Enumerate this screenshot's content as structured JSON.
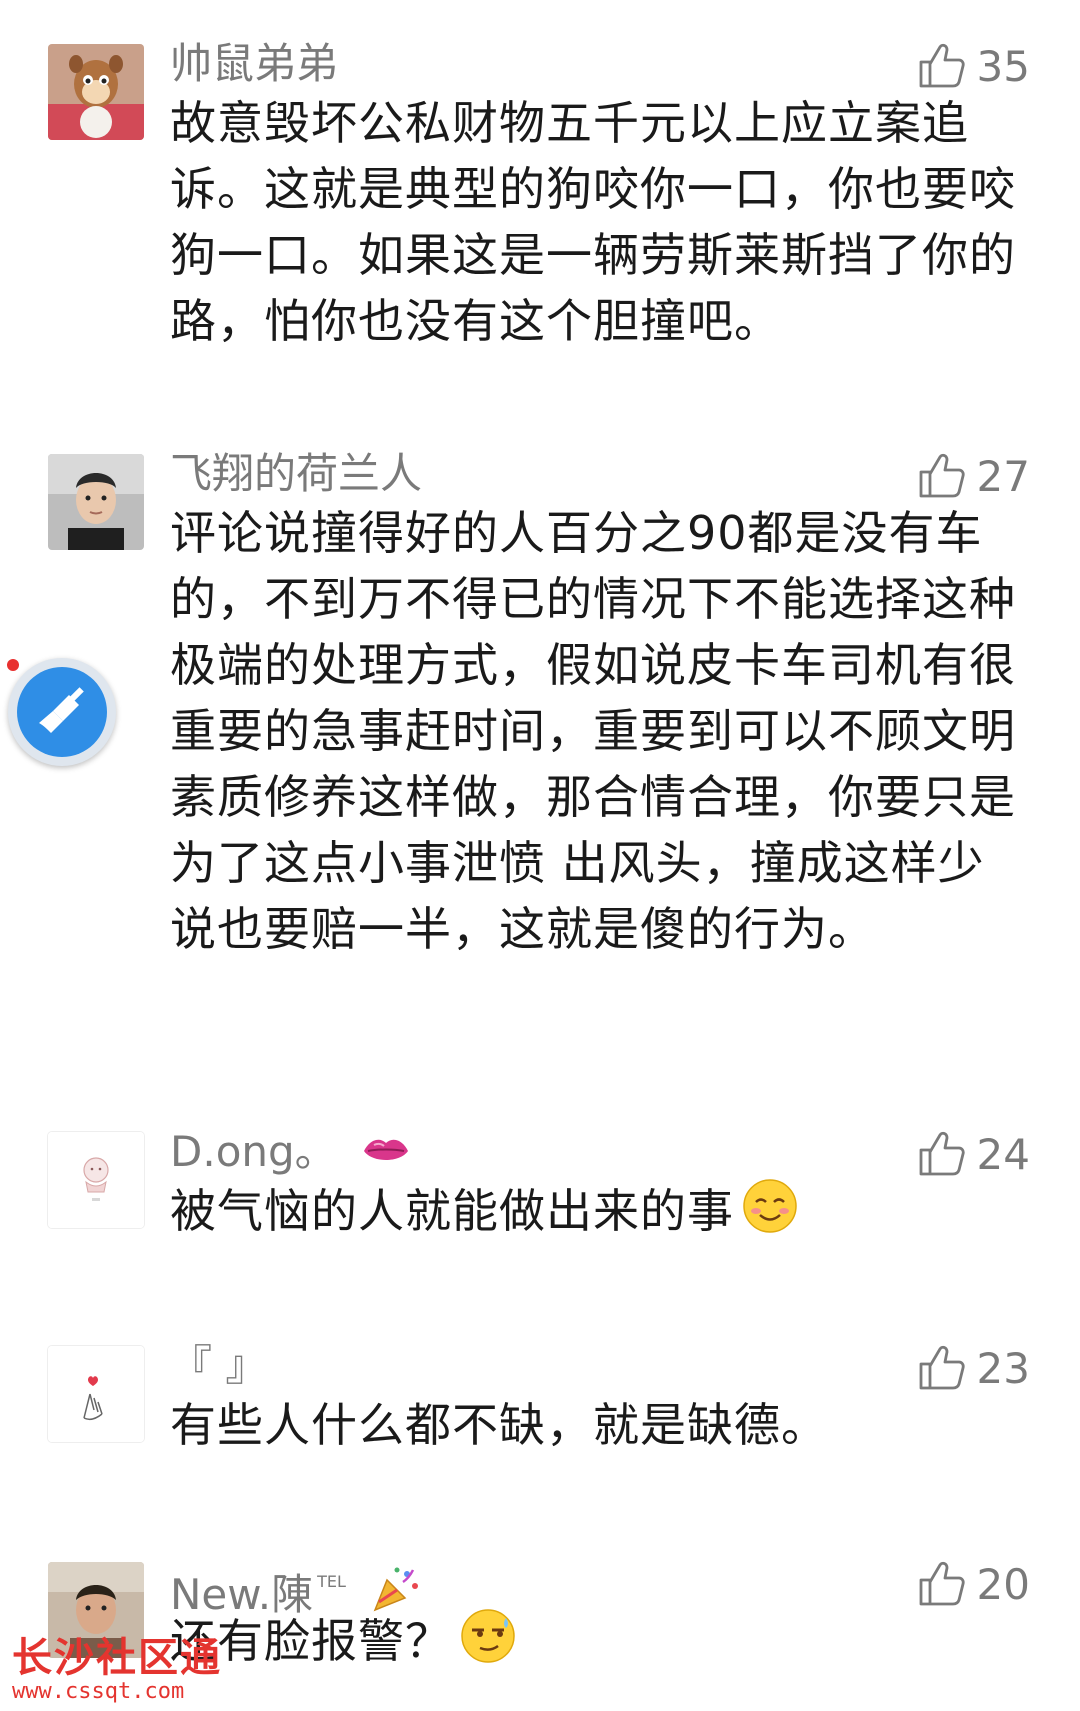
{
  "comments": [
    {
      "username": "帅鼠弟弟",
      "likes": "35",
      "text": "故意毁坏公私财物五千元以上应立案追诉。这就是典型的狗咬你一口，你也要咬狗一口。如果这是一辆劳斯莱斯挡了你的路，怕你也没有这个胆撞吧。",
      "avatar_icon": "chipmunk-avatar"
    },
    {
      "username": "飞翔的荷兰人",
      "likes": "27",
      "text": "评论说撞得好的人百分之90都是没有车的，不到万不得已的情况下不能选择这种极端的处理方式，假如说皮卡车司机有很重要的急事赶时间，重要到可以不顾文明素质修养这样做，那合情合理，你要只是为了这点小事泄愤 出风头，撞成这样少说也要赔一半，这就是傻的行为。",
      "avatar_icon": "man-photo-avatar"
    },
    {
      "username": "D.ong。",
      "username_emoji": "kiss-lips-emoji",
      "likes": "24",
      "text": "被气恼的人就能做出来的事",
      "text_emoji": "smiling-blush-emoji",
      "avatar_icon": "cartoon-girl-avatar"
    },
    {
      "username": "『 』",
      "likes": "23",
      "text": "有些人什么都不缺，就是缺德。",
      "avatar_icon": "finger-heart-avatar"
    },
    {
      "username": "New.陳",
      "username_suffix": "TEL",
      "username_emoji": "party-popper-emoji",
      "likes": "20",
      "text": "还有脸报警？",
      "text_emoji": "smug-face-emoji",
      "avatar_icon": "young-man-photo-avatar"
    }
  ],
  "floating_button": {
    "icon": "broom-icon"
  },
  "watermark": {
    "title": "长沙社区通",
    "url": "www.cssqt.com"
  },
  "colors": {
    "username": "#7a7a7a",
    "text": "#1a1a1a",
    "likes": "#7a7a7a",
    "accent_blue": "#2f8ee6",
    "watermark_red": "#e4342f"
  }
}
